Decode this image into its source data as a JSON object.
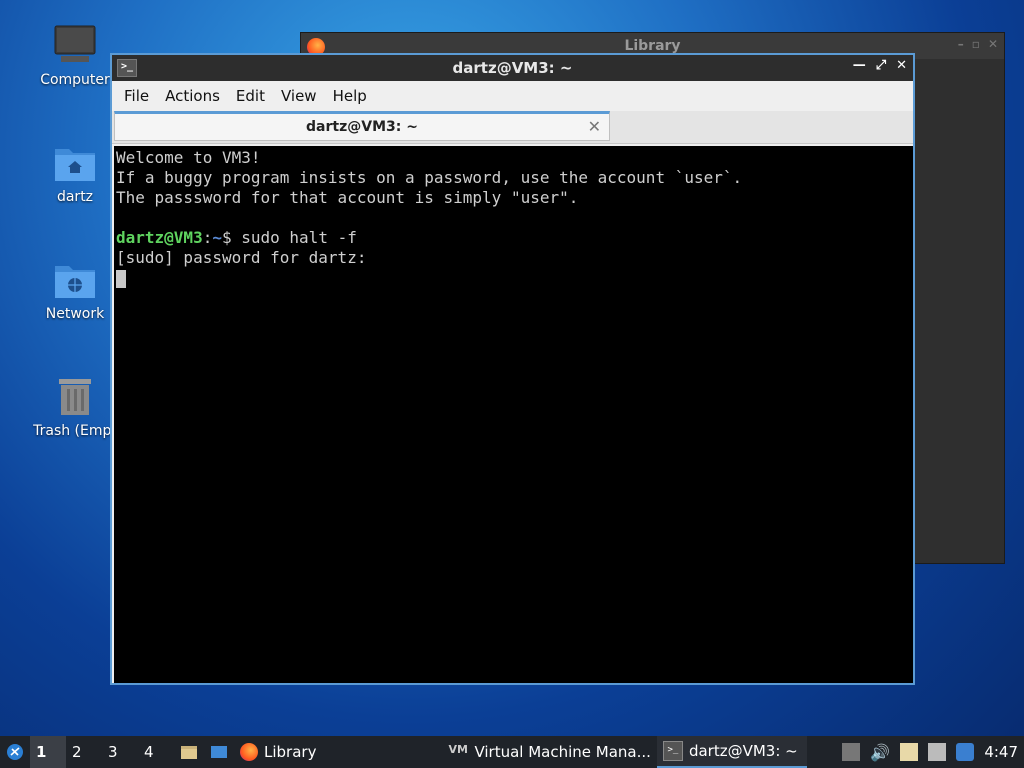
{
  "desktop": {
    "icons": [
      {
        "label": "Computer"
      },
      {
        "label": "dartz"
      },
      {
        "label": "Network"
      },
      {
        "label": "Trash (Empt"
      }
    ]
  },
  "background_window": {
    "title": "Library"
  },
  "terminal": {
    "title": "dartz@VM3: ~",
    "menu": [
      "File",
      "Actions",
      "Edit",
      "View",
      "Help"
    ],
    "tab_label": "dartz@VM3: ~",
    "lines": [
      "Welcome to VM3!",
      "If a buggy program insists on a password, use the account `user`.",
      "The passsword for that account is simply \"user\"."
    ],
    "prompt_user": "dartz@VM3",
    "prompt_sep": ":",
    "prompt_path": "~",
    "prompt_symbol": "$ ",
    "command": "sudo halt -f",
    "sudo_line": "[sudo] password for dartz:"
  },
  "taskbar": {
    "workspaces": [
      "1",
      "2",
      "3",
      "4"
    ],
    "tasks": [
      "Library",
      "Virtual Machine Mana...",
      "dartz@VM3: ~"
    ],
    "clock": "4:47"
  },
  "colors": {
    "accent": "#5b9bd5",
    "prompt_green": "#5fd35f",
    "prompt_blue": "#5b8bd6"
  }
}
